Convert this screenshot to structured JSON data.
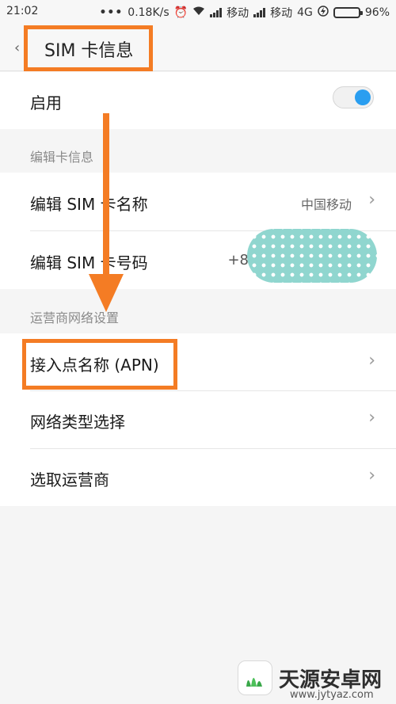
{
  "status_bar": {
    "time": "21:02",
    "dots": "•••",
    "network_speed": "0.18K/s",
    "carrier1": "移动",
    "carrier2": "移动",
    "network_type": "4G",
    "battery": "96%",
    "battery_level": 0.96
  },
  "header": {
    "title": "SIM  卡信息"
  },
  "enable_row": {
    "label": "启用",
    "toggle_on": true
  },
  "section_edit": "编辑卡信息",
  "rows_edit": [
    {
      "label": "编辑 SIM 卡名称",
      "value": "中国移动"
    },
    {
      "label": "编辑 SIM 卡号码",
      "value": "+8"
    }
  ],
  "section_network": "运营商网络设置",
  "rows_network": [
    {
      "label": "接入点名称 (APN)"
    },
    {
      "label": "网络类型选择"
    },
    {
      "label": "选取运营商"
    }
  ],
  "colors": {
    "accent": "#2a9ef0",
    "annotation": "#f47c24"
  },
  "watermark": {
    "name": "天源安卓网",
    "url": "www.jytyaz.com"
  }
}
